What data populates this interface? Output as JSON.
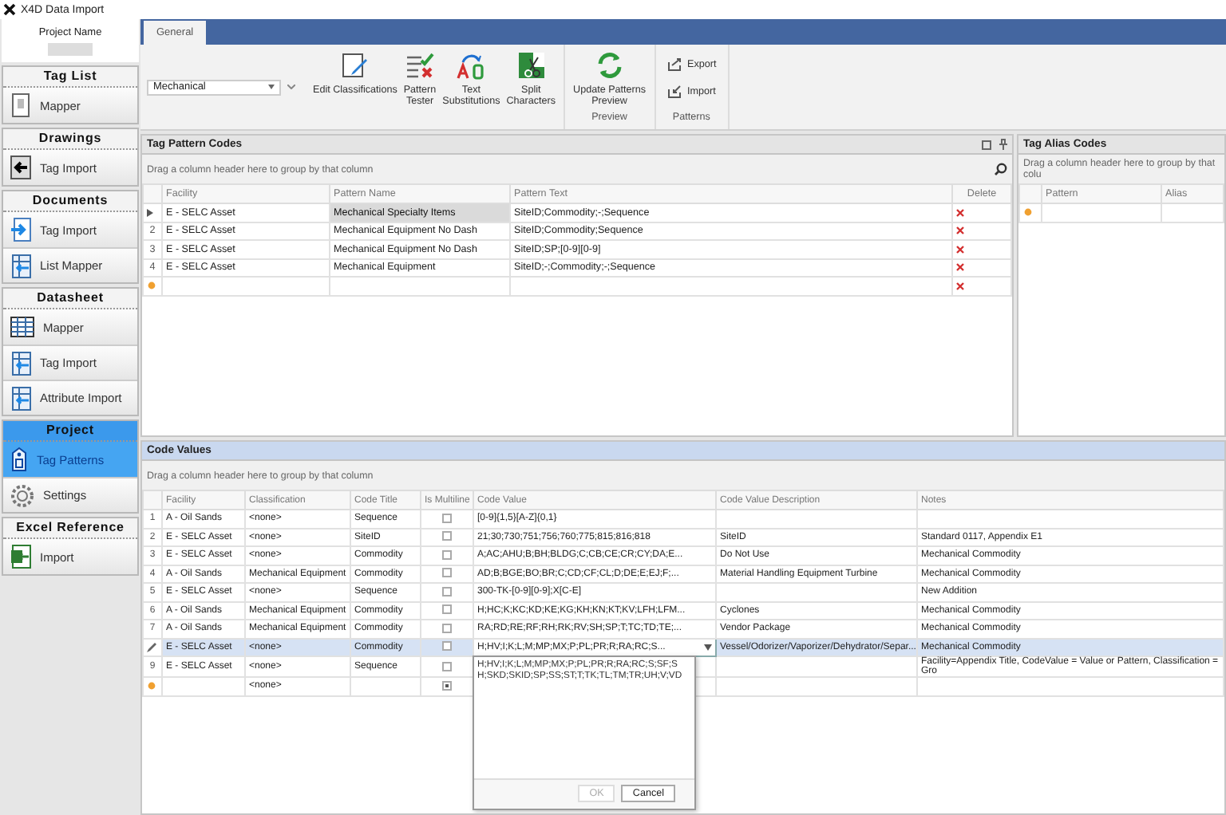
{
  "window": {
    "title": "X4D Data Import"
  },
  "sidebar": {
    "project_name_label": "Project Name",
    "groups": [
      {
        "title": "Tag List",
        "active": false,
        "items": [
          {
            "label": "Mapper",
            "selected": false
          }
        ]
      },
      {
        "title": "Drawings",
        "active": false,
        "items": [
          {
            "label": "Tag Import",
            "selected": false
          }
        ]
      },
      {
        "title": "Documents",
        "active": false,
        "items": [
          {
            "label": "Tag Import",
            "selected": false
          },
          {
            "label": "List Mapper",
            "selected": false
          }
        ]
      },
      {
        "title": "Datasheet",
        "active": false,
        "items": [
          {
            "label": "Mapper",
            "selected": false
          },
          {
            "label": "Tag Import",
            "selected": false
          },
          {
            "label": "Attribute Import",
            "selected": false
          }
        ]
      },
      {
        "title": "Project",
        "active": true,
        "items": [
          {
            "label": "Tag Patterns",
            "selected": true
          },
          {
            "label": "Settings",
            "selected": false
          }
        ]
      },
      {
        "title": "Excel Reference",
        "active": false,
        "items": [
          {
            "label": "Import",
            "selected": false
          }
        ]
      }
    ]
  },
  "ribbon": {
    "tabs": [
      {
        "label": "General",
        "selected": true
      }
    ],
    "classification_dropdown": {
      "value": "Mechanical"
    },
    "groups": [
      {
        "buttons": [
          {
            "label": "Edit Classifications"
          },
          {
            "label": "Pattern\nTester"
          },
          {
            "label": "Text\nSubstitutions"
          },
          {
            "label": "Split\nCharacters"
          }
        ]
      },
      {
        "label": "Preview",
        "buttons": [
          {
            "label": "Update Patterns\nPreview"
          }
        ]
      },
      {
        "label": "Patterns",
        "small_buttons": [
          {
            "label": "Export"
          },
          {
            "label": "Import"
          }
        ]
      }
    ]
  },
  "tag_pattern_codes": {
    "title": "Tag Pattern Codes",
    "group_hint": "Drag a column header here to group by that column",
    "columns": [
      "Facility",
      "Pattern Name",
      "Pattern Text",
      "Delete"
    ],
    "rows": [
      {
        "kind": "current",
        "selected": true,
        "cells": [
          "E - SELC Asset",
          "Mechanical Specialty Items",
          "SiteID;Commodity;-;Sequence"
        ]
      },
      {
        "kind": "numbered",
        "number": "2",
        "selected": false,
        "cells": [
          "E - SELC Asset",
          "Mechanical Equipment No Dash",
          "SiteID;Commodity;Sequence"
        ]
      },
      {
        "kind": "numbered",
        "number": "3",
        "selected": false,
        "cells": [
          "E - SELC Asset",
          "Mechanical Equipment No Dash",
          "SiteID;SP;[0-9][0-9]"
        ]
      },
      {
        "kind": "numbered",
        "number": "4",
        "selected": false,
        "cells": [
          "E - SELC Asset",
          "Mechanical Equipment",
          "SiteID;-;Commodity;-;Sequence"
        ]
      },
      {
        "kind": "new",
        "selected": false,
        "cells": []
      }
    ]
  },
  "tag_alias_codes": {
    "title": "Tag Alias Codes",
    "group_hint": "Drag a column header here to group by that colu",
    "columns": [
      "Pattern",
      "Alias"
    ],
    "rows": [
      {
        "kind": "new",
        "selected": false,
        "cells": []
      }
    ]
  },
  "code_values": {
    "title": "Code Values",
    "group_hint": "Drag a column header here to group by that column",
    "columns": [
      "Facility",
      "Classification",
      "Code Title",
      "Is Multiline",
      "Code Value",
      "Code Value Description",
      "Notes"
    ],
    "rows": [
      {
        "kind": "numbered",
        "number": "1",
        "selected": false,
        "checked": false,
        "indeterminate": false,
        "cells": [
          "A - Oil Sands",
          "<none>",
          "Sequence",
          null,
          "[0-9]{1,5}[A-Z]{0,1}"
        ]
      },
      {
        "kind": "numbered",
        "number": "2",
        "selected": false,
        "checked": false,
        "indeterminate": false,
        "cells": [
          "E - SELC Asset",
          "<none>",
          "SiteID",
          null,
          "21;30;730;751;756;760;775;815;816;818",
          "SiteID",
          "Standard 0117, Appendix E1"
        ]
      },
      {
        "kind": "numbered",
        "number": "3",
        "selected": false,
        "checked": false,
        "indeterminate": false,
        "cells": [
          "E - SELC Asset",
          "<none>",
          "Commodity",
          null,
          "A;AC;AHU;B;BH;BLDG;C;CB;CE;CR;CY;DA;E...",
          "Do Not Use",
          "Mechanical Commodity"
        ]
      },
      {
        "kind": "numbered",
        "number": "4",
        "selected": false,
        "checked": false,
        "indeterminate": false,
        "cells": [
          "A - Oil Sands",
          "Mechanical Equipment",
          "Commodity",
          null,
          "AD;B;BGE;BO;BR;C;CD;CF;CL;D;DE;E;EJ;F;...",
          "Material Handling Equipment Turbine",
          "Mechanical Commodity"
        ]
      },
      {
        "kind": "numbered",
        "number": "5",
        "selected": false,
        "checked": false,
        "indeterminate": false,
        "cells": [
          "E - SELC Asset",
          "<none>",
          "Sequence",
          null,
          "300-TK-[0-9][0-9];X[C-E]",
          null,
          "New Addition"
        ]
      },
      {
        "kind": "numbered",
        "number": "6",
        "selected": false,
        "checked": false,
        "indeterminate": false,
        "cells": [
          "A - Oil Sands",
          "Mechanical Equipment",
          "Commodity",
          null,
          "H;HC;K;KC;KD;KE;KG;KH;KN;KT;KV;LFH;LFM...",
          "Cyclones",
          "Mechanical Commodity"
        ]
      },
      {
        "kind": "numbered",
        "number": "7",
        "selected": false,
        "checked": false,
        "indeterminate": false,
        "cells": [
          "A - Oil Sands",
          "Mechanical Equipment",
          "Commodity",
          null,
          "RA;RD;RE;RF;RH;RK;RV;SH;SP;T;TC;TD;TE;...",
          "Vendor Package",
          "Mechanical Commodity"
        ]
      },
      {
        "kind": "editing",
        "selected": true,
        "checked": false,
        "indeterminate": false,
        "cells": [
          "E - SELC Asset",
          "<none>",
          "Commodity",
          null,
          "H;HV;I;K;L;M;MP;MX;P;PL;PR;R;RA;RC;S...",
          "Vessel/Odorizer/Vaporizer/Dehydrator/Separ...",
          "Mechanical Commodity"
        ]
      },
      {
        "kind": "numbered",
        "number": "9",
        "selected": false,
        "checked": false,
        "indeterminate": false,
        "cells": [
          "E - SELC Asset",
          "<none>",
          "Sequence",
          null,
          null,
          null,
          "Facility=Appendix Title, CodeValue = Value or Pattern, Classification = Gro"
        ]
      },
      {
        "kind": "new",
        "selected": false,
        "checked": false,
        "indeterminate": true,
        "cells": [
          null,
          "<none>"
        ]
      }
    ],
    "editor_popup": {
      "lines": [
        "H;HV;I;K;L;M;MP;MX;P;PL;PR;R;RA;RC;S;SF;S",
        "H;SKD;SKID;SP;SS;ST;T;TK;TL;TM;TR;UH;V;VD"
      ],
      "buttons": [
        {
          "label": "OK",
          "disabled": true
        },
        {
          "label": "Cancel",
          "disabled": false
        }
      ]
    }
  }
}
